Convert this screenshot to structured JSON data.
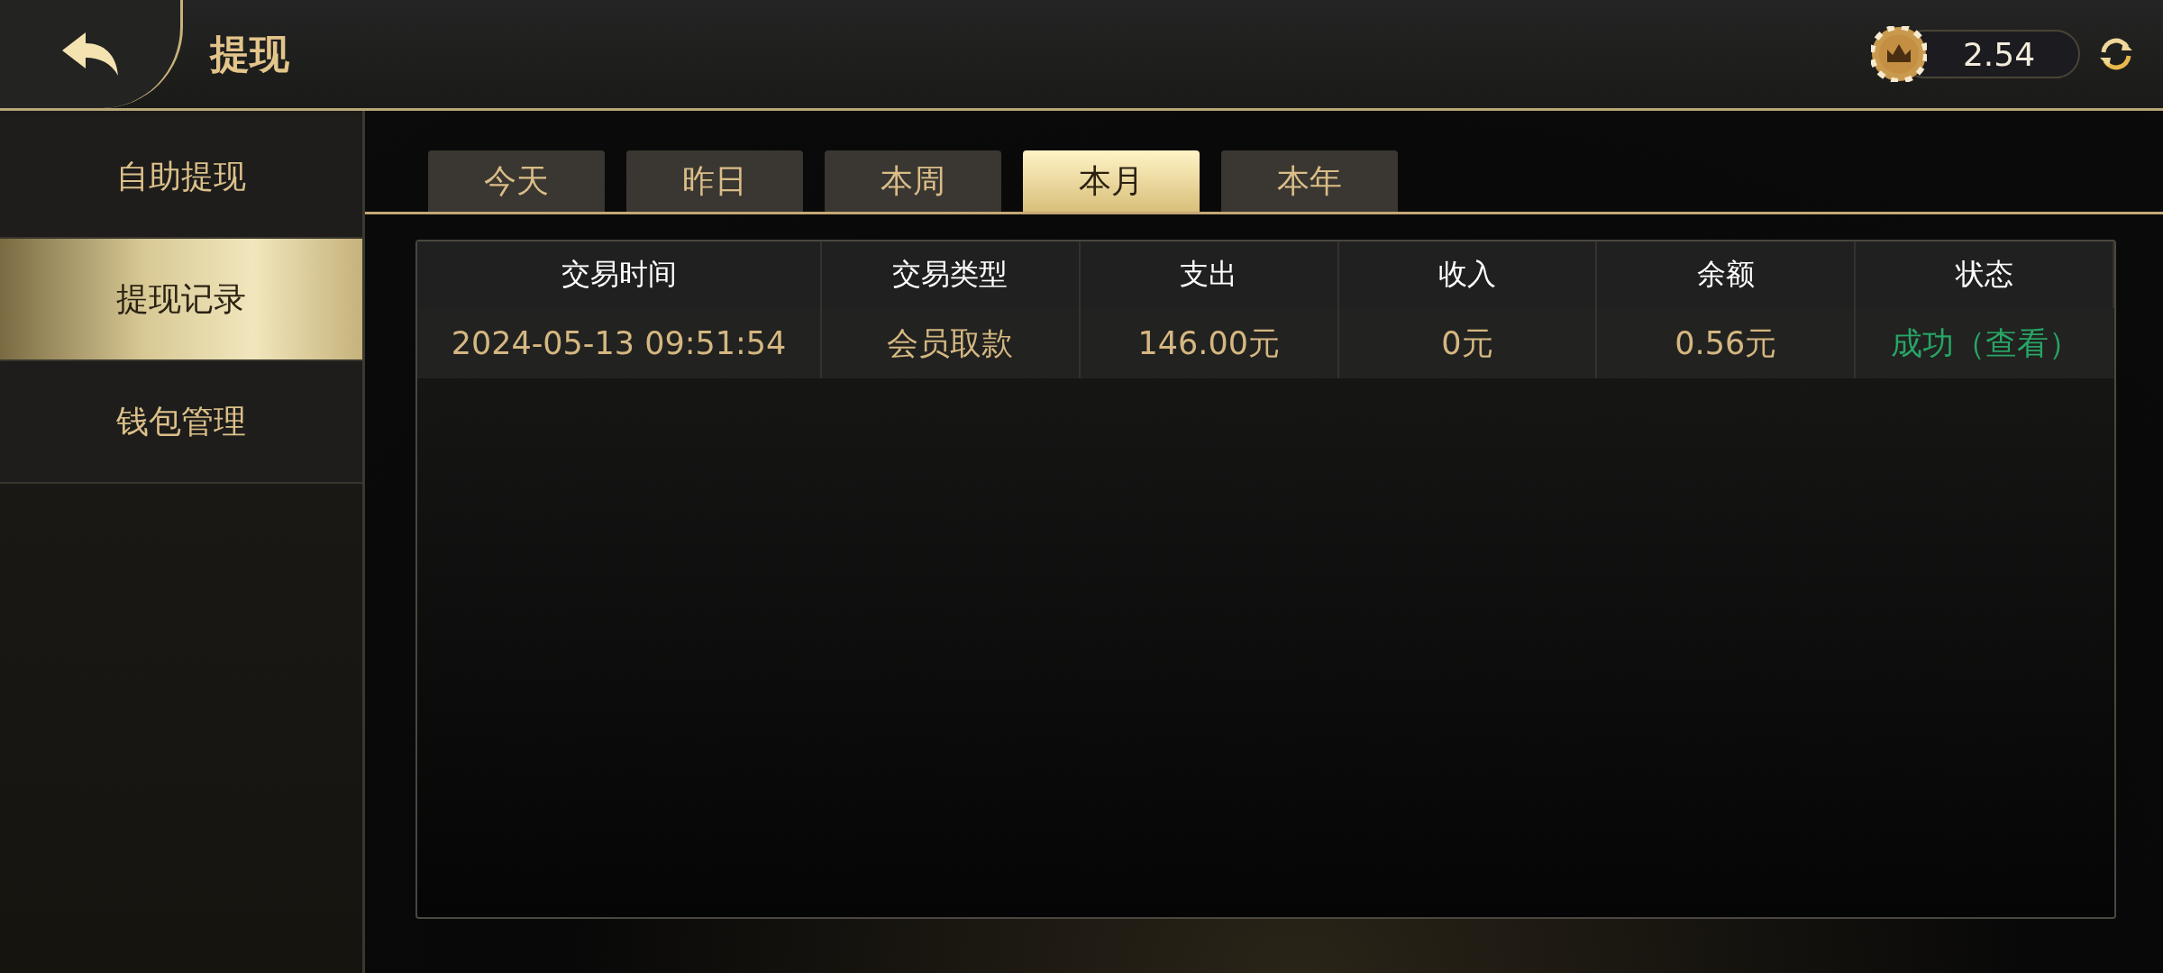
{
  "header": {
    "title": "提现",
    "balance": "2.54"
  },
  "sidebar": {
    "items": [
      {
        "label": "自助提现",
        "selected": false
      },
      {
        "label": "提现记录",
        "selected": true
      },
      {
        "label": "钱包管理",
        "selected": false
      }
    ]
  },
  "tabs": [
    {
      "label": "今天",
      "selected": false
    },
    {
      "label": "昨日",
      "selected": false
    },
    {
      "label": "本周",
      "selected": false
    },
    {
      "label": "本月",
      "selected": true
    },
    {
      "label": "本年",
      "selected": false
    }
  ],
  "table": {
    "columns": [
      "交易时间",
      "交易类型",
      "支出",
      "收入",
      "余额",
      "状态"
    ],
    "rows": [
      {
        "cells": [
          "2024-05-13 09:51:54",
          "会员取款",
          "146.00元",
          "0元",
          "0.56元"
        ],
        "status": "成功（查看）"
      }
    ]
  }
}
